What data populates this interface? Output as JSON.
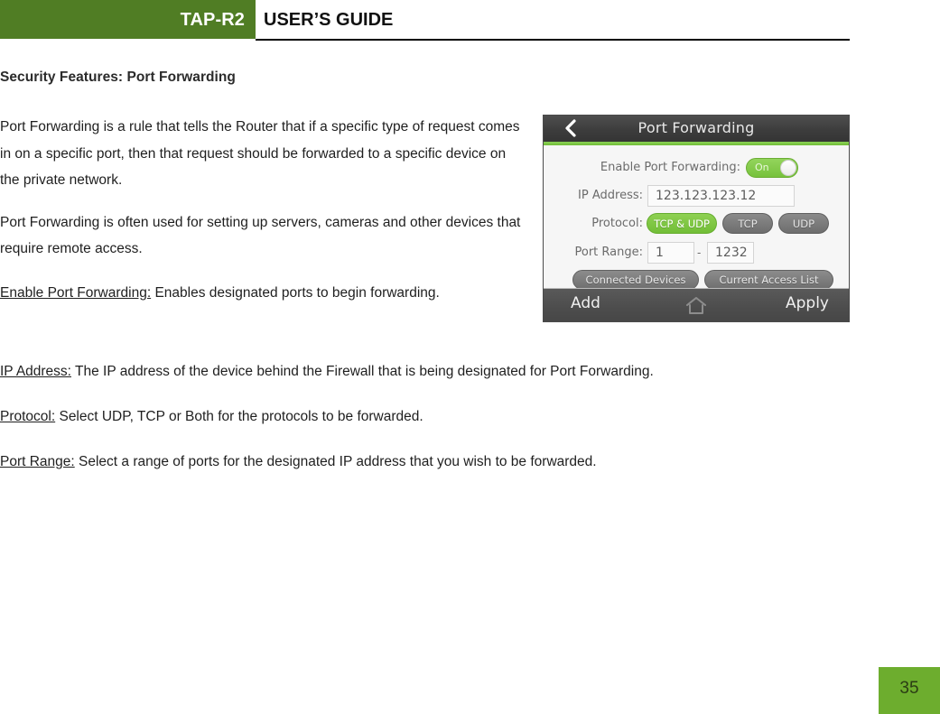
{
  "header": {
    "product": "TAP-R2",
    "title": "USER’S GUIDE"
  },
  "section_heading": "Security Features: Port Forwarding",
  "paragraphs": {
    "intro": " Port Forwarding is a rule that tells the Router that if a specific type of request comes in on a specific port, then that request should be forwarded to a specific device on the private network.",
    "usage": "Port Forwarding is often used for setting up servers, cameras and other devices that require remote access.",
    "enable_term": "Enable Port Forwarding:",
    "enable_desc": " Enables designated ports to begin forwarding.",
    "ip_term": "IP Address:",
    "ip_desc": "  The IP address of the device behind the Firewall that is being designated for Port Forwarding.",
    "protocol_term": "Protocol:",
    "protocol_desc": " Select UDP, TCP or Both for the protocols to be forwarded.",
    "port_range_term": "Port Range:",
    "port_range_desc": " Select a range of ports for the designated IP address that you wish to be forwarded."
  },
  "device": {
    "topbar": {
      "back_icon": "chevron-left-icon",
      "title": "Port Forwarding"
    },
    "enable": {
      "label": "Enable Port Forwarding:",
      "toggle_state": "On"
    },
    "ip_address": {
      "label": "IP Address:",
      "value": "123.123.123.12"
    },
    "protocol": {
      "label": "Protocol:",
      "options": [
        {
          "label": "TCP & UDP",
          "selected": true
        },
        {
          "label": "TCP",
          "selected": false
        },
        {
          "label": "UDP",
          "selected": false
        }
      ]
    },
    "port_range": {
      "label": "Port Range:",
      "start": "1",
      "separator": "-",
      "end": "1232"
    },
    "buttons": {
      "connected_devices": "Connected Devices",
      "current_access_list": "Current Access List"
    },
    "bottombar": {
      "add": "Add",
      "home_icon": "home-icon",
      "apply": "Apply"
    }
  },
  "page_number": "35",
  "colors": {
    "header_green": "#507D24",
    "page_number_green": "#6DAD2E",
    "device_accent_green": "#7AC943",
    "device_dark": "#3D3D3D"
  }
}
